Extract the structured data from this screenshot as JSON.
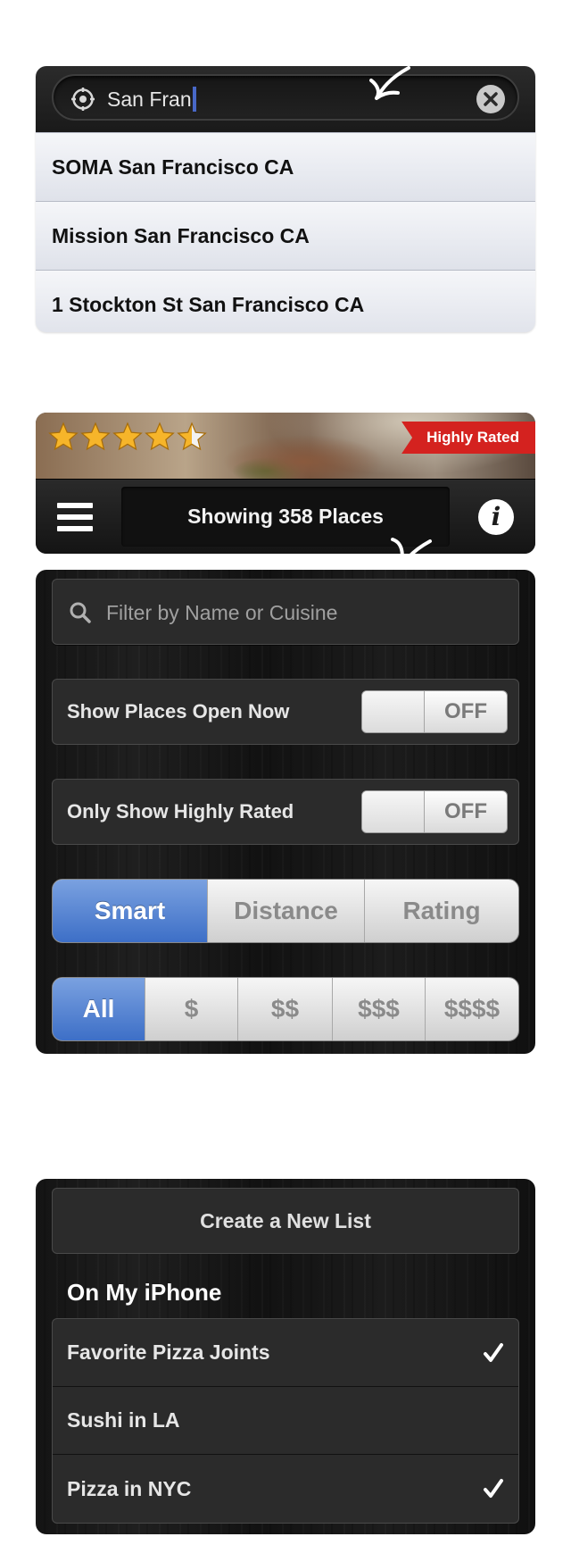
{
  "search": {
    "query": "San Fran",
    "suggestions": [
      "SOMA San Francisco CA",
      "Mission San Francisco CA",
      "1 Stockton St San Francisco CA"
    ]
  },
  "header": {
    "rating": 4.5,
    "badge": "Highly Rated",
    "title": "Showing 358 Places"
  },
  "filters": {
    "placeholder": "Filter by Name or Cuisine",
    "open_now": {
      "label": "Show Places Open Now",
      "state": "OFF"
    },
    "highly_rated": {
      "label": "Only Show Highly Rated",
      "state": "OFF"
    },
    "sort": {
      "options": [
        "Smart",
        "Distance",
        "Rating"
      ],
      "selected": "Smart"
    },
    "price": {
      "options": [
        "All",
        "$",
        "$$",
        "$$$",
        "$$$$"
      ],
      "selected": "All"
    }
  },
  "lists": {
    "create_label": "Create a New List",
    "section_title": "On My iPhone",
    "items": [
      {
        "name": "Favorite Pizza Joints",
        "checked": true
      },
      {
        "name": "Sushi in LA",
        "checked": false
      },
      {
        "name": "Pizza in NYC",
        "checked": true
      }
    ]
  },
  "colors": {
    "accent_blue": "#3d6fc7",
    "badge_red": "#d4221f",
    "star_gold": "#f6b52a",
    "caret": "#4868c8"
  }
}
